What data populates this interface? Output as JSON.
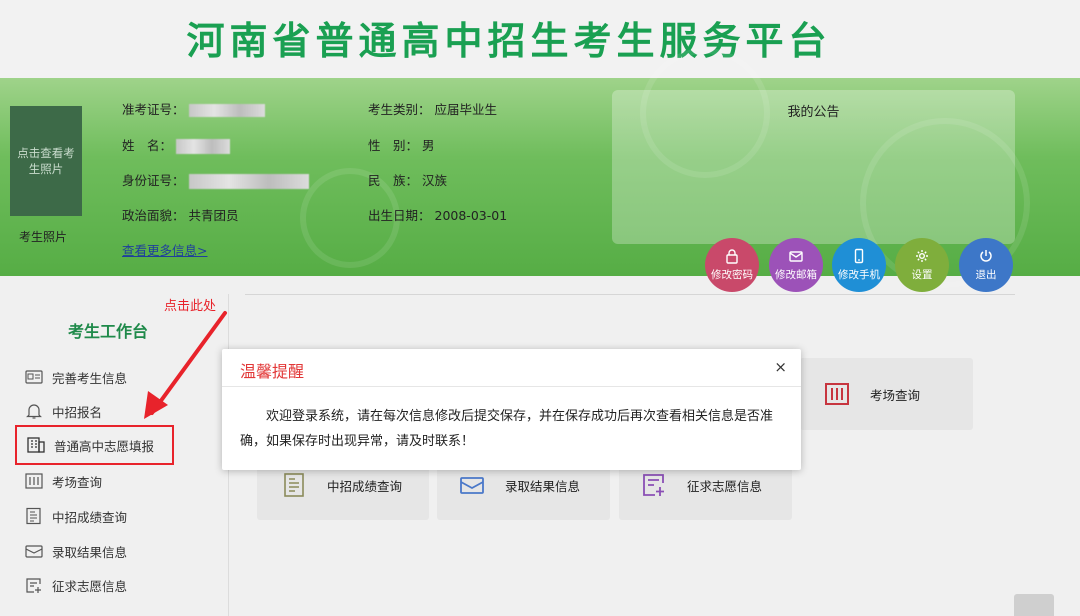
{
  "site": {
    "title": "河南省普通高中招生考生服务平台"
  },
  "student": {
    "photo_placeholder": "点击查看考生照片",
    "photo_label": "考生照片",
    "exam_no_label": "准考证号：",
    "name_label": "姓　名：",
    "id_label": "身份证号：",
    "political_label": "政治面貌：",
    "political_value": "共青团员",
    "category_label": "考生类别：",
    "category_value": "应届毕业生",
    "gender_label": "性　别：",
    "gender_value": "男",
    "ethnicity_label": "民　族：",
    "ethnicity_value": "汉族",
    "birth_label": "出生日期：",
    "birth_value": "2008-03-01",
    "more_link": "查看更多信息>"
  },
  "notice": {
    "title": "我的公告"
  },
  "actions": [
    {
      "label": "修改密码",
      "icon": "lock-icon",
      "color": "#c9496a"
    },
    {
      "label": "修改邮箱",
      "icon": "mail-icon",
      "color": "#9c52b8"
    },
    {
      "label": "修改手机",
      "icon": "phone-icon",
      "color": "#1f8fd6"
    },
    {
      "label": "设置",
      "icon": "gear-icon",
      "color": "#7fae3c"
    },
    {
      "label": "退出",
      "icon": "power-icon",
      "color": "#3d77c8"
    }
  ],
  "sidebar": {
    "title": "考生工作台",
    "annotation": "点击此处",
    "items": [
      {
        "label": "完善考生信息",
        "icon": "id-card-icon"
      },
      {
        "label": "中招报名",
        "icon": "bell-icon"
      },
      {
        "label": "普通高中志愿填报",
        "icon": "building-icon"
      },
      {
        "label": "考场查询",
        "icon": "seat-grid-icon"
      },
      {
        "label": "中招成绩查询",
        "icon": "score-doc-icon"
      },
      {
        "label": "录取结果信息",
        "icon": "envelope-icon"
      },
      {
        "label": "征求志愿信息",
        "icon": "add-form-icon"
      }
    ]
  },
  "cards": [
    {
      "label": "考场查询",
      "icon": "seat-grid-icon"
    },
    {
      "label": "中招成绩查询",
      "icon": "score-doc-icon"
    },
    {
      "label": "录取结果信息",
      "icon": "envelope-icon"
    },
    {
      "label": "征求志愿信息",
      "icon": "add-form-icon"
    }
  ],
  "dialog": {
    "title": "温馨提醒",
    "close": "×",
    "message": "欢迎登录系统，请在每次信息修改后提交保存，并在保存成功后再次查看相关信息是否准确，如果保存时出现异常，请及时联系！"
  },
  "colors": {
    "brand_green": "#1aa052",
    "alert_red": "#e8232b"
  }
}
